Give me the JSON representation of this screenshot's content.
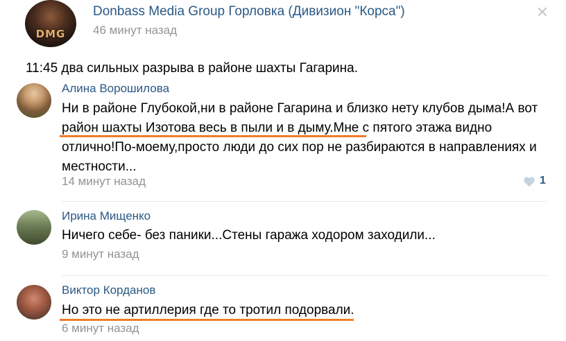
{
  "post": {
    "group_name": "Donbass Media Group Горловка (Дивизион \"Корса\")",
    "time": "46 минут назад",
    "avatar_text": "DMG",
    "text": "11:45 два сильных разрыва в районе шахты Гагарина."
  },
  "comments": [
    {
      "author": "Алина Ворошилова",
      "text": "Ни в районе Глубокой,ни в районе Гагарина и близко нету клубов дыма!А вот район шахты Изотова весь в пыли и в дыму.Мне с пятого этажа видно отлично!По-моему,просто люди до сих пор не разбираются в направлениях и местности...",
      "time": "14 минут назад",
      "likes": "1"
    },
    {
      "author": "Ирина Мищенко",
      "text": "Ничего себе- без паники...Стены гаража ходором заходили...",
      "time": "9 минут назад"
    },
    {
      "author": "Виктор Корданов",
      "text": "Но это не артиллерия где то тротил подорвали.",
      "time": "6 минут назад"
    }
  ],
  "colors": {
    "link": "#2a5885",
    "muted": "#939393",
    "highlight_underline": "#f07b2c"
  },
  "icons": {
    "close": "close-icon",
    "like": "heart-icon"
  }
}
